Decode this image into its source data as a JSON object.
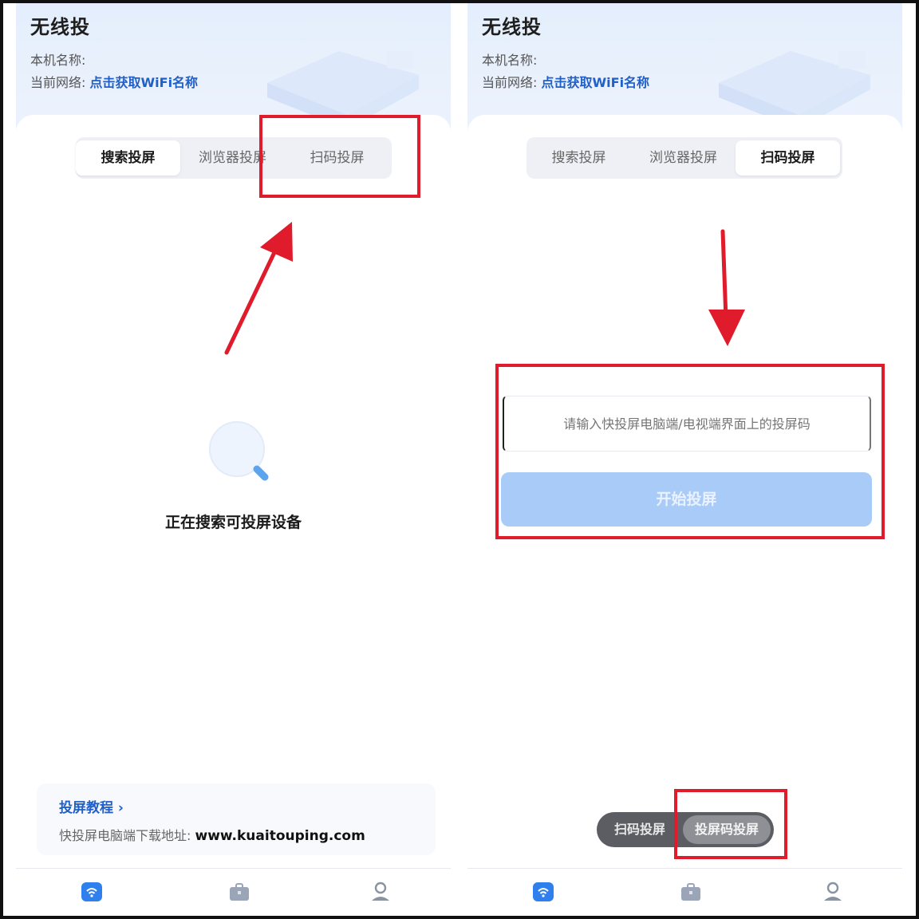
{
  "left": {
    "app_title": "无线投",
    "device_name_label": "本机名称:",
    "network_label": "当前网络:",
    "network_link": "点击获取WiFi名称",
    "tabs": [
      {
        "label": "搜索投屏",
        "active": true
      },
      {
        "label": "浏览器投屏",
        "active": false
      },
      {
        "label": "扫码投屏",
        "active": false
      }
    ],
    "searching_text": "正在搜索可投屏设备",
    "tutorial_link": "投屏教程 ›",
    "download_label": "快投屏电脑端下载地址:",
    "download_url": "www.kuaitouping.com"
  },
  "right": {
    "app_title": "无线投",
    "device_name_label": "本机名称:",
    "network_label": "当前网络:",
    "network_link": "点击获取WiFi名称",
    "tabs": [
      {
        "label": "搜索投屏",
        "active": false
      },
      {
        "label": "浏览器投屏",
        "active": false
      },
      {
        "label": "扫码投屏",
        "active": true
      }
    ],
    "code_placeholder": "请输入快投屏电脑端/电视端界面上的投屏码",
    "start_button": "开始投屏",
    "mode_options": [
      {
        "label": "扫码投屏",
        "active": false
      },
      {
        "label": "投屏码投屏",
        "active": true
      }
    ]
  },
  "nav_icons": [
    "wifi-cast-icon",
    "toolbox-icon",
    "profile-icon"
  ],
  "colors": {
    "accent": "#2060c8",
    "highlight": "#e01b2c",
    "button_disabled": "#a9cbf7",
    "nav_active": "#2f80ed"
  }
}
